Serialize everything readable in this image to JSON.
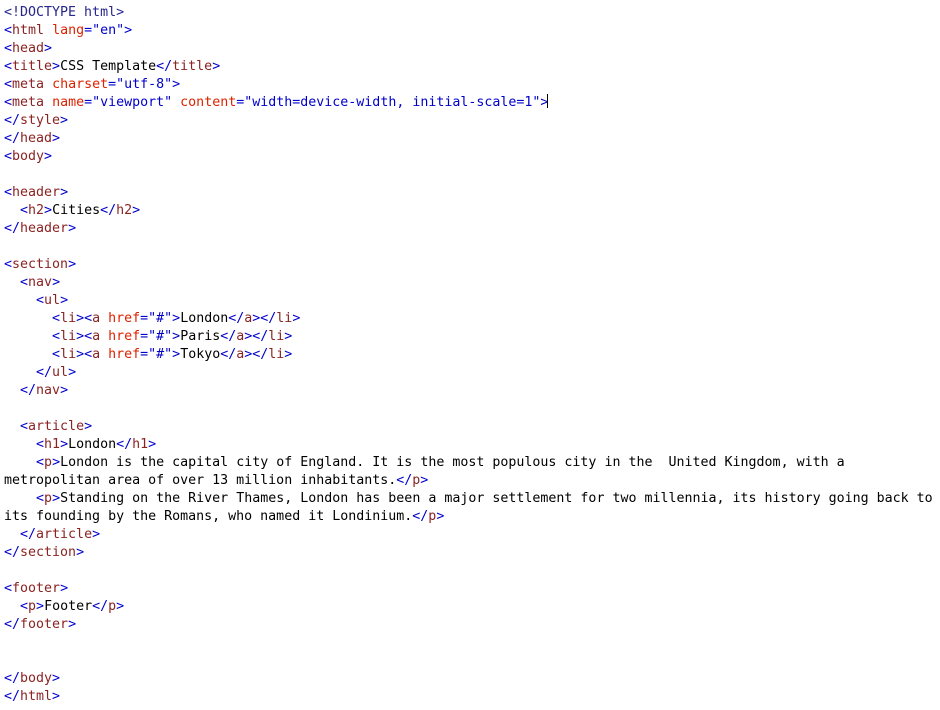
{
  "editor": {
    "language": "html",
    "background_color": "#ffffff",
    "caret_line_index": 6,
    "colors": {
      "punctuation": "#0000cc",
      "tag_name": "#8b2323",
      "attribute_name": "#dd2200",
      "attribute_value": "#0000cc",
      "text_content": "#000000",
      "doctype": "#26268c"
    }
  },
  "lines": [
    {
      "index": 0,
      "text": "<!DOCTYPE html>",
      "tokens": [
        {
          "t": "<!DOCTYPE html>",
          "k": "doctype"
        }
      ]
    },
    {
      "index": 1,
      "text": "<html lang=\"en\">",
      "tokens": [
        {
          "t": "<",
          "k": "punct"
        },
        {
          "t": "html",
          "k": "tag"
        },
        {
          "t": " ",
          "k": "text"
        },
        {
          "t": "lang",
          "k": "attr"
        },
        {
          "t": "=\"en\">",
          "k": "value"
        }
      ]
    },
    {
      "index": 2,
      "text": "<head>",
      "tokens": [
        {
          "t": "<",
          "k": "punct"
        },
        {
          "t": "head",
          "k": "tag"
        },
        {
          "t": ">",
          "k": "punct"
        }
      ]
    },
    {
      "index": 3,
      "text": "<title>CSS Template</title>",
      "tokens": [
        {
          "t": "<",
          "k": "punct"
        },
        {
          "t": "title",
          "k": "tag"
        },
        {
          "t": ">",
          "k": "punct"
        },
        {
          "t": "CSS Template",
          "k": "text"
        },
        {
          "t": "</",
          "k": "punct"
        },
        {
          "t": "title",
          "k": "tag"
        },
        {
          "t": ">",
          "k": "punct"
        }
      ]
    },
    {
      "index": 4,
      "text": "<meta charset=\"utf-8\">",
      "tokens": [
        {
          "t": "<",
          "k": "punct"
        },
        {
          "t": "meta",
          "k": "tag"
        },
        {
          "t": " ",
          "k": "text"
        },
        {
          "t": "charset",
          "k": "attr"
        },
        {
          "t": "=\"utf-8\">",
          "k": "value"
        }
      ]
    },
    {
      "index": 5,
      "text": "<meta name=\"viewport\" content=\"width=device-width, initial-scale=1\">",
      "tokens": [
        {
          "t": "<",
          "k": "punct"
        },
        {
          "t": "meta",
          "k": "tag"
        },
        {
          "t": " ",
          "k": "text"
        },
        {
          "t": "name",
          "k": "attr"
        },
        {
          "t": "=\"viewport\" ",
          "k": "value"
        },
        {
          "t": "content",
          "k": "attr"
        },
        {
          "t": "=\"width=device-width, initial-scale=1\">",
          "k": "value"
        }
      ],
      "caret_after": true
    },
    {
      "index": 6,
      "text": "</style>",
      "tokens": [
        {
          "t": "</",
          "k": "punct"
        },
        {
          "t": "style",
          "k": "tag"
        },
        {
          "t": ">",
          "k": "punct"
        }
      ]
    },
    {
      "index": 7,
      "text": "</head>",
      "tokens": [
        {
          "t": "</",
          "k": "punct"
        },
        {
          "t": "head",
          "k": "tag"
        },
        {
          "t": ">",
          "k": "punct"
        }
      ]
    },
    {
      "index": 8,
      "text": "<body>",
      "tokens": [
        {
          "t": "<",
          "k": "punct"
        },
        {
          "t": "body",
          "k": "tag"
        },
        {
          "t": ">",
          "k": "punct"
        }
      ]
    },
    {
      "index": 9,
      "text": "",
      "tokens": []
    },
    {
      "index": 10,
      "text": "<header>",
      "tokens": [
        {
          "t": "<",
          "k": "punct"
        },
        {
          "t": "header",
          "k": "tag"
        },
        {
          "t": ">",
          "k": "punct"
        }
      ]
    },
    {
      "index": 11,
      "text": "  <h2>Cities</h2>",
      "tokens": [
        {
          "t": "  ",
          "k": "text"
        },
        {
          "t": "<",
          "k": "punct"
        },
        {
          "t": "h2",
          "k": "tag"
        },
        {
          "t": ">",
          "k": "punct"
        },
        {
          "t": "Cities",
          "k": "text"
        },
        {
          "t": "</",
          "k": "punct"
        },
        {
          "t": "h2",
          "k": "tag"
        },
        {
          "t": ">",
          "k": "punct"
        }
      ]
    },
    {
      "index": 12,
      "text": "</header>",
      "tokens": [
        {
          "t": "</",
          "k": "punct"
        },
        {
          "t": "header",
          "k": "tag"
        },
        {
          "t": ">",
          "k": "punct"
        }
      ]
    },
    {
      "index": 13,
      "text": "",
      "tokens": []
    },
    {
      "index": 14,
      "text": "<section>",
      "tokens": [
        {
          "t": "<",
          "k": "punct"
        },
        {
          "t": "section",
          "k": "tag"
        },
        {
          "t": ">",
          "k": "punct"
        }
      ]
    },
    {
      "index": 15,
      "text": "  <nav>",
      "tokens": [
        {
          "t": "  ",
          "k": "text"
        },
        {
          "t": "<",
          "k": "punct"
        },
        {
          "t": "nav",
          "k": "tag"
        },
        {
          "t": ">",
          "k": "punct"
        }
      ]
    },
    {
      "index": 16,
      "text": "    <ul>",
      "tokens": [
        {
          "t": "    ",
          "k": "text"
        },
        {
          "t": "<",
          "k": "punct"
        },
        {
          "t": "ul",
          "k": "tag"
        },
        {
          "t": ">",
          "k": "punct"
        }
      ]
    },
    {
      "index": 17,
      "text": "      <li><a href=\"#\">London</a></li>",
      "tokens": [
        {
          "t": "      ",
          "k": "text"
        },
        {
          "t": "<",
          "k": "punct"
        },
        {
          "t": "li",
          "k": "tag"
        },
        {
          "t": "><",
          "k": "punct"
        },
        {
          "t": "a",
          "k": "tag"
        },
        {
          "t": " ",
          "k": "text"
        },
        {
          "t": "href",
          "k": "attr"
        },
        {
          "t": "=\"#\">",
          "k": "value"
        },
        {
          "t": "London",
          "k": "text"
        },
        {
          "t": "</",
          "k": "punct"
        },
        {
          "t": "a",
          "k": "tag"
        },
        {
          "t": "></",
          "k": "punct"
        },
        {
          "t": "li",
          "k": "tag"
        },
        {
          "t": ">",
          "k": "punct"
        }
      ]
    },
    {
      "index": 18,
      "text": "      <li><a href=\"#\">Paris</a></li>",
      "tokens": [
        {
          "t": "      ",
          "k": "text"
        },
        {
          "t": "<",
          "k": "punct"
        },
        {
          "t": "li",
          "k": "tag"
        },
        {
          "t": "><",
          "k": "punct"
        },
        {
          "t": "a",
          "k": "tag"
        },
        {
          "t": " ",
          "k": "text"
        },
        {
          "t": "href",
          "k": "attr"
        },
        {
          "t": "=\"#\">",
          "k": "value"
        },
        {
          "t": "Paris",
          "k": "text"
        },
        {
          "t": "</",
          "k": "punct"
        },
        {
          "t": "a",
          "k": "tag"
        },
        {
          "t": "></",
          "k": "punct"
        },
        {
          "t": "li",
          "k": "tag"
        },
        {
          "t": ">",
          "k": "punct"
        }
      ]
    },
    {
      "index": 19,
      "text": "      <li><a href=\"#\">Tokyo</a></li>",
      "tokens": [
        {
          "t": "      ",
          "k": "text"
        },
        {
          "t": "<",
          "k": "punct"
        },
        {
          "t": "li",
          "k": "tag"
        },
        {
          "t": "><",
          "k": "punct"
        },
        {
          "t": "a",
          "k": "tag"
        },
        {
          "t": " ",
          "k": "text"
        },
        {
          "t": "href",
          "k": "attr"
        },
        {
          "t": "=\"#\">",
          "k": "value"
        },
        {
          "t": "Tokyo",
          "k": "text"
        },
        {
          "t": "</",
          "k": "punct"
        },
        {
          "t": "a",
          "k": "tag"
        },
        {
          "t": "></",
          "k": "punct"
        },
        {
          "t": "li",
          "k": "tag"
        },
        {
          "t": ">",
          "k": "punct"
        }
      ]
    },
    {
      "index": 20,
      "text": "    </ul>",
      "tokens": [
        {
          "t": "    ",
          "k": "text"
        },
        {
          "t": "</",
          "k": "punct"
        },
        {
          "t": "ul",
          "k": "tag"
        },
        {
          "t": ">",
          "k": "punct"
        }
      ]
    },
    {
      "index": 21,
      "text": "  </nav>",
      "tokens": [
        {
          "t": "  ",
          "k": "text"
        },
        {
          "t": "</",
          "k": "punct"
        },
        {
          "t": "nav",
          "k": "tag"
        },
        {
          "t": ">",
          "k": "punct"
        }
      ]
    },
    {
      "index": 22,
      "text": "",
      "tokens": []
    },
    {
      "index": 23,
      "text": "  <article>",
      "tokens": [
        {
          "t": "  ",
          "k": "text"
        },
        {
          "t": "<",
          "k": "punct"
        },
        {
          "t": "article",
          "k": "tag"
        },
        {
          "t": ">",
          "k": "punct"
        }
      ]
    },
    {
      "index": 24,
      "text": "    <h1>London</h1>",
      "tokens": [
        {
          "t": "    ",
          "k": "text"
        },
        {
          "t": "<",
          "k": "punct"
        },
        {
          "t": "h1",
          "k": "tag"
        },
        {
          "t": ">",
          "k": "punct"
        },
        {
          "t": "London",
          "k": "text"
        },
        {
          "t": "</",
          "k": "punct"
        },
        {
          "t": "h1",
          "k": "tag"
        },
        {
          "t": ">",
          "k": "punct"
        }
      ]
    },
    {
      "index": 25,
      "text": "    <p>London is the capital city of England. It is the most populous city in the  United Kingdom, with a",
      "tokens": [
        {
          "t": "    ",
          "k": "text"
        },
        {
          "t": "<",
          "k": "punct"
        },
        {
          "t": "p",
          "k": "tag"
        },
        {
          "t": ">",
          "k": "punct"
        },
        {
          "t": "London is the capital city of England. It is the most populous city in the  United Kingdom, with a",
          "k": "text"
        }
      ]
    },
    {
      "index": 26,
      "text": "metropolitan area of over 13 million inhabitants.</p>",
      "tokens": [
        {
          "t": "metropolitan area of over 13 million inhabitants.",
          "k": "text"
        },
        {
          "t": "</",
          "k": "punct"
        },
        {
          "t": "p",
          "k": "tag"
        },
        {
          "t": ">",
          "k": "punct"
        }
      ]
    },
    {
      "index": 27,
      "text": "    <p>Standing on the River Thames, London has been a major settlement for two millennia, its history going back to",
      "tokens": [
        {
          "t": "    ",
          "k": "text"
        },
        {
          "t": "<",
          "k": "punct"
        },
        {
          "t": "p",
          "k": "tag"
        },
        {
          "t": ">",
          "k": "punct"
        },
        {
          "t": "Standing on the River Thames, London has been a major settlement for two millennia, its history going back to",
          "k": "text"
        }
      ]
    },
    {
      "index": 28,
      "text": "its founding by the Romans, who named it Londinium.</p>",
      "tokens": [
        {
          "t": "its founding by the Romans, who named it Londinium.",
          "k": "text"
        },
        {
          "t": "</",
          "k": "punct"
        },
        {
          "t": "p",
          "k": "tag"
        },
        {
          "t": ">",
          "k": "punct"
        }
      ]
    },
    {
      "index": 29,
      "text": "  </article>",
      "tokens": [
        {
          "t": "  ",
          "k": "text"
        },
        {
          "t": "</",
          "k": "punct"
        },
        {
          "t": "article",
          "k": "tag"
        },
        {
          "t": ">",
          "k": "punct"
        }
      ]
    },
    {
      "index": 30,
      "text": "</section>",
      "tokens": [
        {
          "t": "</",
          "k": "punct"
        },
        {
          "t": "section",
          "k": "tag"
        },
        {
          "t": ">",
          "k": "punct"
        }
      ]
    },
    {
      "index": 31,
      "text": "",
      "tokens": []
    },
    {
      "index": 32,
      "text": "<footer>",
      "tokens": [
        {
          "t": "<",
          "k": "punct"
        },
        {
          "t": "footer",
          "k": "tag"
        },
        {
          "t": ">",
          "k": "punct"
        }
      ]
    },
    {
      "index": 33,
      "text": "  <p>Footer</p>",
      "tokens": [
        {
          "t": "  ",
          "k": "text"
        },
        {
          "t": "<",
          "k": "punct"
        },
        {
          "t": "p",
          "k": "tag"
        },
        {
          "t": ">",
          "k": "punct"
        },
        {
          "t": "Footer",
          "k": "text"
        },
        {
          "t": "</",
          "k": "punct"
        },
        {
          "t": "p",
          "k": "tag"
        },
        {
          "t": ">",
          "k": "punct"
        }
      ]
    },
    {
      "index": 34,
      "text": "</footer>",
      "tokens": [
        {
          "t": "</",
          "k": "punct"
        },
        {
          "t": "footer",
          "k": "tag"
        },
        {
          "t": ">",
          "k": "punct"
        }
      ]
    },
    {
      "index": 35,
      "text": "",
      "tokens": []
    },
    {
      "index": 36,
      "text": "",
      "tokens": []
    },
    {
      "index": 37,
      "text": "</body>",
      "tokens": [
        {
          "t": "</",
          "k": "punct"
        },
        {
          "t": "body",
          "k": "tag"
        },
        {
          "t": ">",
          "k": "punct"
        }
      ]
    },
    {
      "index": 38,
      "text": "</html>",
      "tokens": [
        {
          "t": "</",
          "k": "punct"
        },
        {
          "t": "html",
          "k": "tag"
        },
        {
          "t": ">",
          "k": "punct"
        }
      ]
    }
  ]
}
